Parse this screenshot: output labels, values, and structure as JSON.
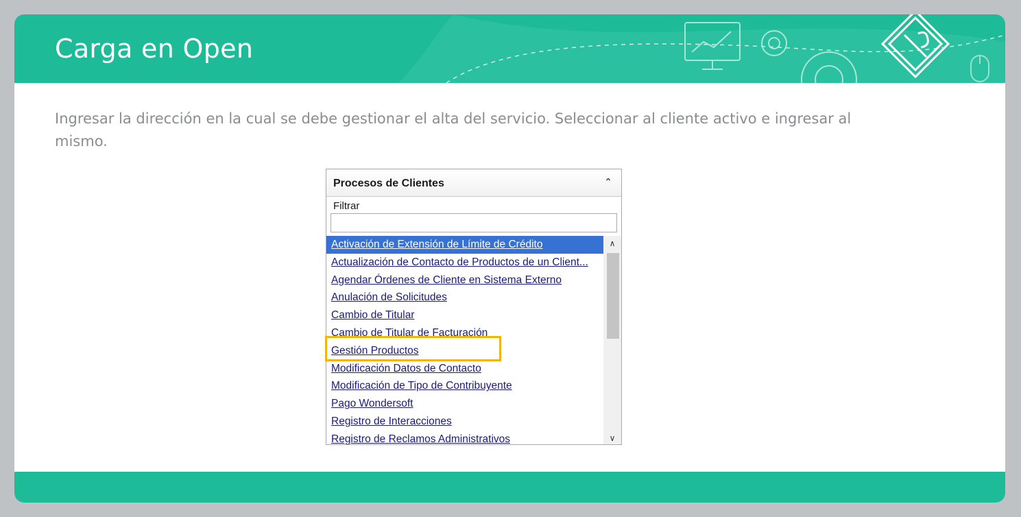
{
  "slide": {
    "title": "Carga en Open",
    "instruction": "Ingresar la dirección en la cual se debe gestionar el alta del servicio. Seleccionar al cliente activo e ingresar al mismo."
  },
  "panel": {
    "title": "Procesos de Clientes",
    "collapse_icon": "double-chevron-up-icon",
    "filter_label": "Filtrar",
    "filter_value": "",
    "items": [
      {
        "label": "Activación de Extensión de Límite de Crédito",
        "selected": true
      },
      {
        "label": "Actualización de Contacto de Productos de un Client..."
      },
      {
        "label": "Agendar Órdenes de Cliente en Sistema Externo"
      },
      {
        "label": "Anulación de Solicitudes"
      },
      {
        "label": "Cambio de Titular"
      },
      {
        "label": "Cambio de Titular de Facturación"
      },
      {
        "label": "Gestión Productos",
        "highlighted": true
      },
      {
        "label": "Modificación Datos de Contacto"
      },
      {
        "label": "Modificación de Tipo de Contribuyente"
      },
      {
        "label": "Pago Wondersoft"
      },
      {
        "label": "Registro de Interacciones"
      },
      {
        "label": "Registro de Reclamos Administrativos"
      }
    ]
  },
  "colors": {
    "header": "#1dbb98",
    "selection": "#3771d2",
    "highlight": "#f2b705"
  }
}
